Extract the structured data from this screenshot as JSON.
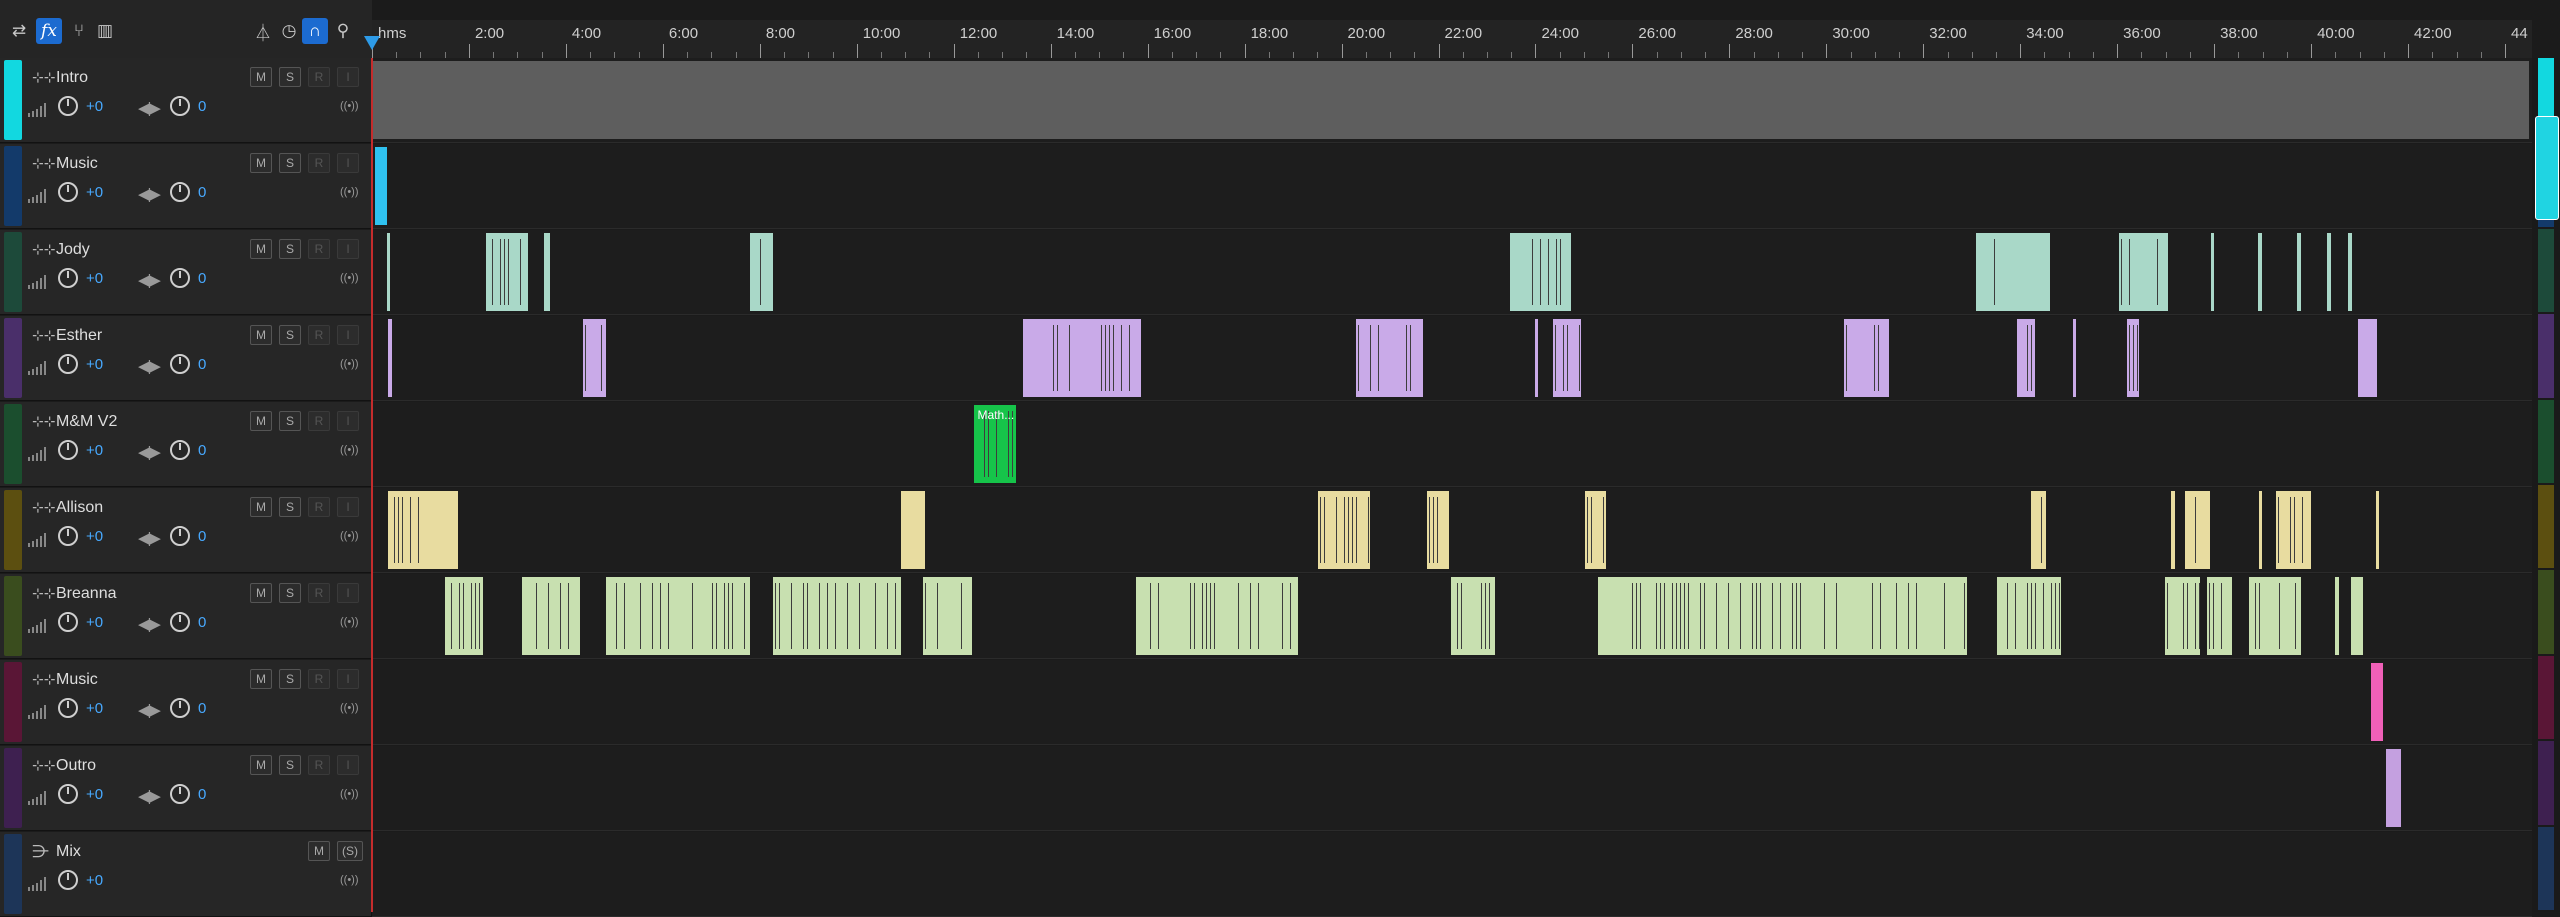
{
  "toolbar": {
    "icons": [
      "switch-icon",
      "fx-icon",
      "branch-icon",
      "bar-chart-icon",
      "metronome-icon",
      "timer-icon",
      "magnet-icon",
      "marker-icon"
    ],
    "fx_label": "fx"
  },
  "ruler": {
    "unit": "hms",
    "labels": [
      "2:00",
      "4:00",
      "6:00",
      "8:00",
      "10:00",
      "12:00",
      "14:00",
      "16:00",
      "18:00",
      "20:00",
      "22:00",
      "24:00",
      "26:00",
      "28:00",
      "30:00",
      "32:00",
      "34:00",
      "36:00",
      "38:00",
      "40:00",
      "42:00",
      "44"
    ]
  },
  "colors": {
    "accent": "#1c6bd0",
    "value": "#47a9ff",
    "playhead": "#c42c2c"
  },
  "tracks": [
    {
      "name": "Intro",
      "strip": "#12d8e0",
      "vol": "+0",
      "pan": "0",
      "clip_color": "#5e5e5e"
    },
    {
      "name": "Music",
      "strip": "#133a6a",
      "vol": "+0",
      "pan": "0",
      "clip_color": "#2fc2f0"
    },
    {
      "name": "Jody",
      "strip": "#1d4a3a",
      "vol": "+0",
      "pan": "0",
      "clip_color": "#a9d8c8"
    },
    {
      "name": "Esther",
      "strip": "#4a2f6a",
      "vol": "+0",
      "pan": "0",
      "clip_color": "#c9aae8"
    },
    {
      "name": "M&M V2",
      "strip": "#1b4e2e",
      "vol": "+0",
      "pan": "0",
      "clip_color": "#16c44a",
      "clip_label": "Math..."
    },
    {
      "name": "Allison",
      "strip": "#5c4f10",
      "vol": "+0",
      "pan": "0",
      "clip_color": "#e8dca0"
    },
    {
      "name": "Breanna",
      "strip": "#3a4d1e",
      "vol": "+0",
      "pan": "0",
      "clip_color": "#c8e0b0"
    },
    {
      "name": "Music",
      "strip": "#5a1636",
      "vol": "+0",
      "pan": "0",
      "clip_color": "#f060b8"
    },
    {
      "name": "Outro",
      "strip": "#3e2050",
      "vol": "+0",
      "pan": "0",
      "clip_color": "#c4a0e0"
    }
  ],
  "mix": {
    "name": "Mix",
    "strip": "#1d3558",
    "vol": "+0"
  },
  "buttons": {
    "mute": "M",
    "solo": "S",
    "record": "R",
    "input": "I",
    "mix_solo": "(S)"
  },
  "clips": [
    [
      [
        0,
        0.9987
      ]
    ],
    [
      [
        0.0015,
        0.0068
      ]
    ],
    [
      [
        0.0068,
        0.0082
      ],
      [
        0.0528,
        0.0723
      ],
      [
        0.0798,
        0.0826
      ],
      [
        0.1749,
        0.1856
      ],
      [
        0.5269,
        0.5553
      ],
      [
        0.7426,
        0.7767
      ],
      [
        0.8086,
        0.8314
      ],
      [
        0.8513,
        0.853
      ],
      [
        0.8732,
        0.875
      ],
      [
        0.8913,
        0.893
      ],
      [
        0.9053,
        0.907
      ],
      [
        0.915,
        0.9165
      ]
    ],
    [
      [
        0.0076,
        0.0092
      ],
      [
        0.0978,
        0.1084
      ],
      [
        0.3016,
        0.3559
      ],
      [
        0.4555,
        0.4864
      ],
      [
        0.5383,
        0.5398
      ],
      [
        0.5468,
        0.5598
      ],
      [
        0.6817,
        0.7021
      ],
      [
        0.7616,
        0.7699
      ],
      [
        0.7873,
        0.7888
      ],
      [
        0.8124,
        0.818
      ],
      [
        0.9193,
        0.9283
      ]
    ],
    [
      [
        0.2785,
        0.2983
      ]
    ],
    [
      [
        0.0076,
        0.0398
      ],
      [
        0.2451,
        0.2561
      ],
      [
        0.4379,
        0.462
      ],
      [
        0.4886,
        0.4986
      ],
      [
        0.5618,
        0.5715
      ],
      [
        0.7681,
        0.7751
      ],
      [
        0.8331,
        0.8346
      ],
      [
        0.8393,
        0.8511
      ],
      [
        0.8735,
        0.875
      ],
      [
        0.8816,
        0.8975
      ],
      [
        0.9279,
        0.9294
      ]
    ],
    [
      [
        0.0338,
        0.0514
      ],
      [
        0.0696,
        0.0962
      ],
      [
        0.1084,
        0.1749
      ],
      [
        0.1856,
        0.2451
      ],
      [
        0.2553,
        0.2776
      ],
      [
        0.3537,
        0.4286
      ],
      [
        0.4997,
        0.52
      ],
      [
        0.5675,
        0.7383
      ],
      [
        0.7525,
        0.7818
      ],
      [
        0.8299,
        0.8463
      ],
      [
        0.8495,
        0.861
      ],
      [
        0.869,
        0.8932
      ],
      [
        0.909,
        0.9105
      ],
      [
        0.9164,
        0.9219
      ]
    ],
    [
      [
        0.9254,
        0.931
      ]
    ],
    [
      [
        0.9326,
        0.9394
      ]
    ]
  ],
  "scrollbar_segments": [
    "#12d8e0",
    "#133a6a",
    "#1d4a3a",
    "#4a2f6a",
    "#1b4e2e",
    "#5c4f10",
    "#3a4d1e",
    "#5a1636",
    "#3e2050",
    "#1d3558"
  ]
}
